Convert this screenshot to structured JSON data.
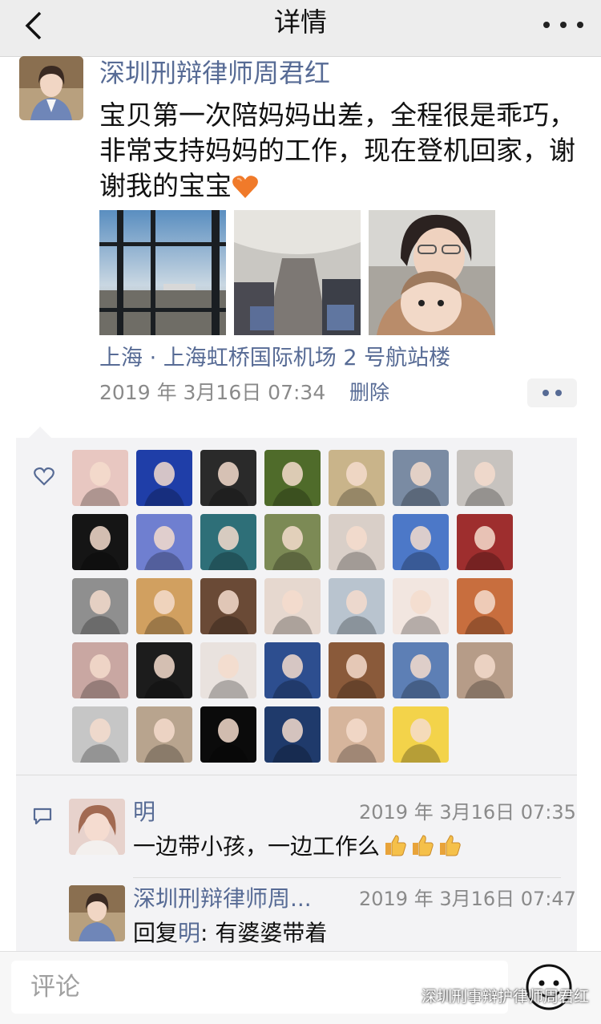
{
  "header": {
    "title": "详情",
    "back_icon": "chevron-left-icon",
    "more_icon": "more-dots-icon"
  },
  "post": {
    "author": "深圳刑辩律师周君红",
    "text": "宝贝第一次陪妈妈出差，全程很是乖巧，非常支持妈妈的工作，现在登机回家，谢谢我的宝宝",
    "emoji": "orange-heart-emoji",
    "photos": [
      "airport-window-photo",
      "airplane-cabin-photo",
      "mother-baby-selfie-photo"
    ],
    "location": "上海 · 上海虹桥国际机场 2 号航站楼",
    "timestamp": "2019 年 3月16日 07:34",
    "delete_label": "删除"
  },
  "likes": {
    "icon": "heart-outline-icon",
    "avatars": [
      {
        "color": "#e8c7c1"
      },
      {
        "color": "#1f3ea8"
      },
      {
        "color": "#2a2a2a"
      },
      {
        "color": "#4f6b2a"
      },
      {
        "color": "#c9b48a"
      },
      {
        "color": "#7a8ba3"
      },
      {
        "color": "#c7c3bf"
      },
      {
        "color": "#151515"
      },
      {
        "color": "#6f7fd0"
      },
      {
        "color": "#2e6f78"
      },
      {
        "color": "#7c8a55"
      },
      {
        "color": "#d9cfc8"
      },
      {
        "color": "#4c78c8"
      },
      {
        "color": "#9e2e2e"
      },
      {
        "color": "#8f8f8f"
      },
      {
        "color": "#d1a060"
      },
      {
        "color": "#6a4a36"
      },
      {
        "color": "#e6d8cf"
      },
      {
        "color": "#b9c4cf"
      },
      {
        "color": "#f2e6e0"
      },
      {
        "color": "#c86e3e"
      },
      {
        "color": "#c9a7a2"
      },
      {
        "color": "#1c1c1c"
      },
      {
        "color": "#e9e2de"
      },
      {
        "color": "#2d4e8f"
      },
      {
        "color": "#8a5a3a"
      },
      {
        "color": "#5d7fb5"
      },
      {
        "color": "#b69c88"
      },
      {
        "color": "#c6c6c6"
      },
      {
        "color": "#b8a48e"
      },
      {
        "color": "#0b0b0b"
      },
      {
        "color": "#1f3a6b"
      },
      {
        "color": "#d6b59c"
      },
      {
        "color": "#f3d34a"
      }
    ]
  },
  "comments": {
    "icon": "comment-bubble-icon",
    "items": [
      {
        "name": "明",
        "time": "2019 年 3月16日 07:35",
        "text": "一边带小孩，一边工作么",
        "emoji": "thumbs-up-emoji"
      },
      {
        "name": "深圳刑辩律师周...",
        "time": "2019 年 3月16日 07:47",
        "reply_prefix": "回复",
        "reply_to": "明",
        "text": ": 有婆婆带着"
      }
    ]
  },
  "footer": {
    "input_placeholder": "评论",
    "emoji_icon": "smiley-face-icon",
    "watermark": "深圳刑事辩护律师周君红"
  }
}
